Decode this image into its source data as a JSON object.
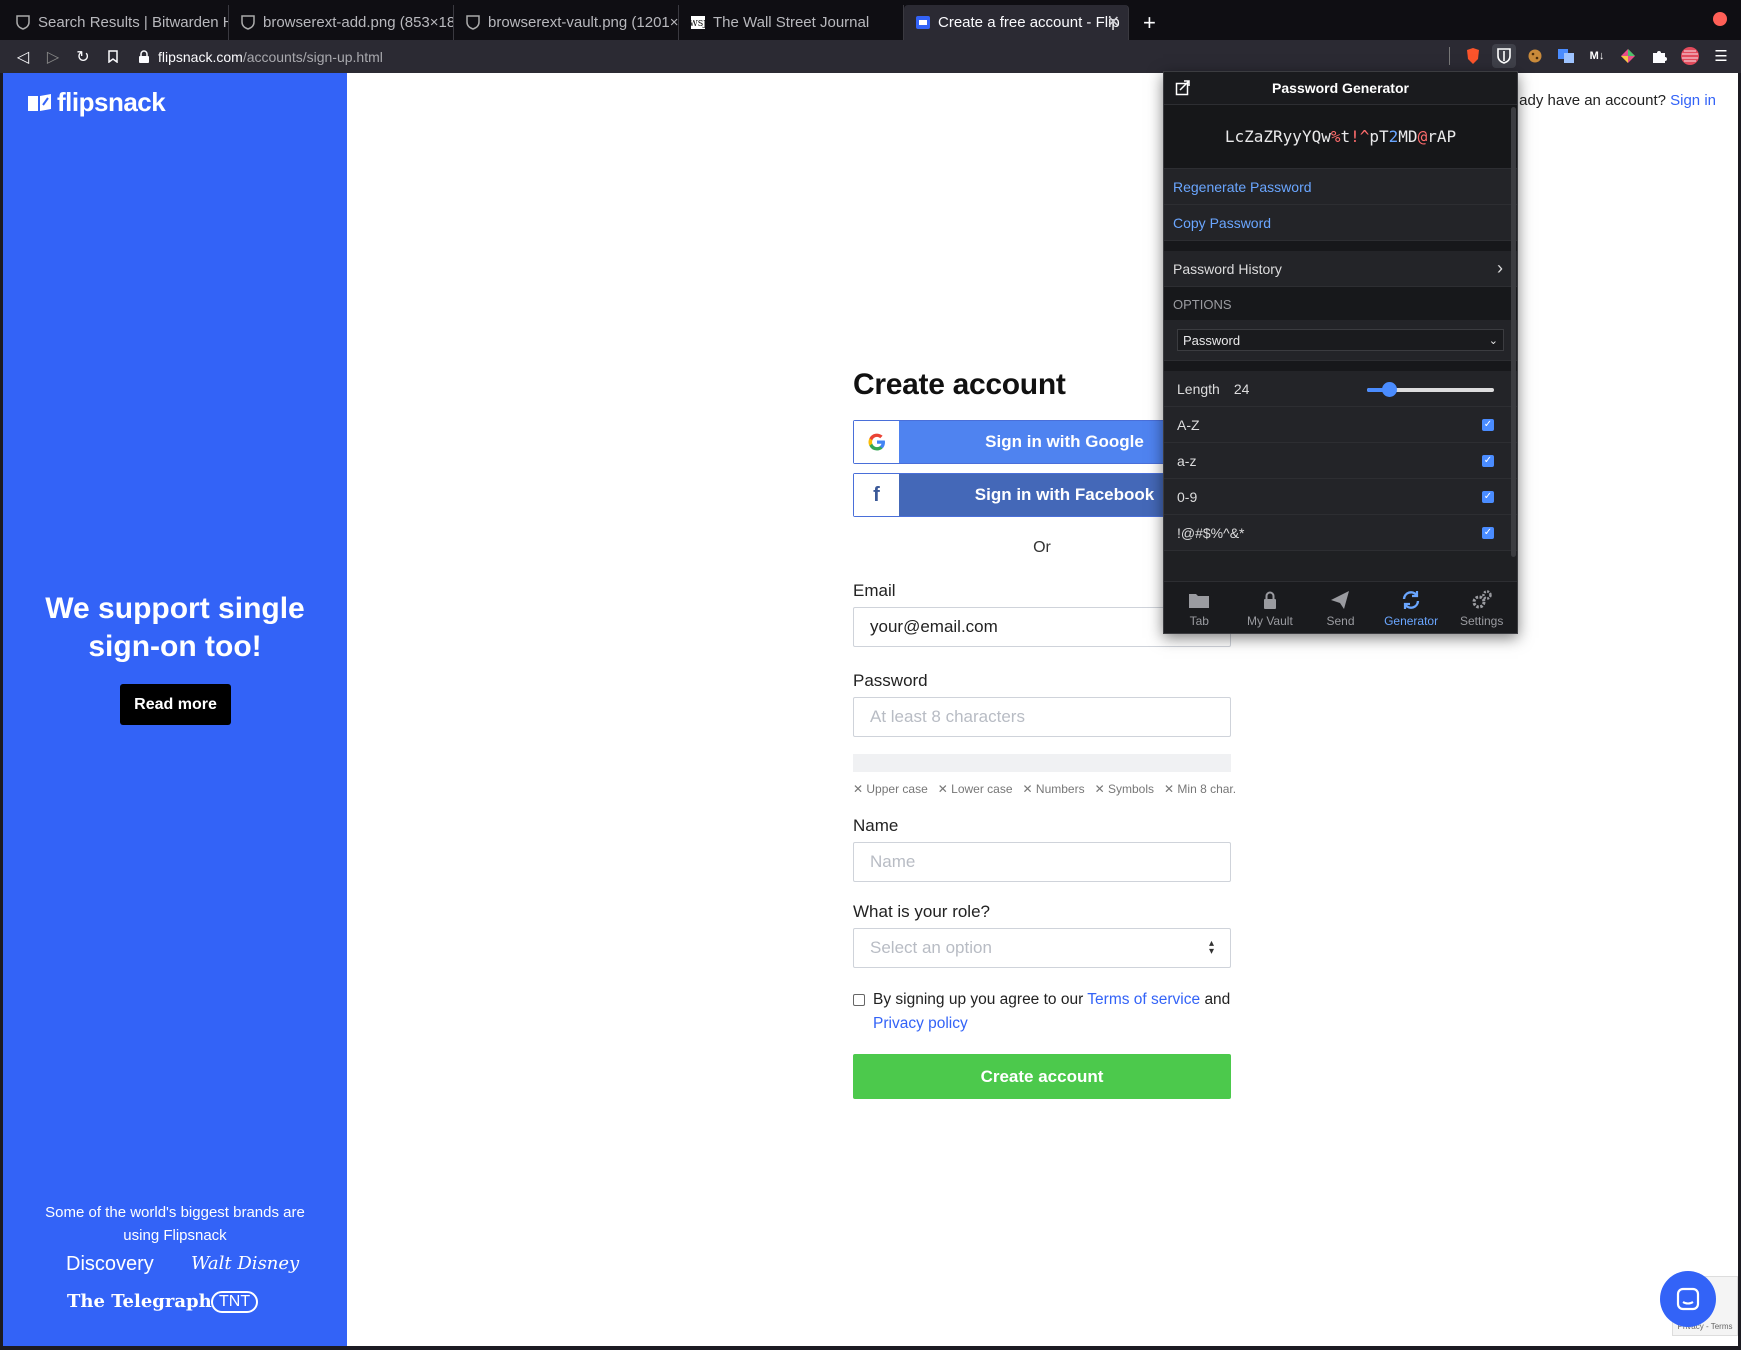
{
  "browser": {
    "tabs": [
      {
        "title": "Search Results | Bitwarden He",
        "active": false
      },
      {
        "title": "browserext-add.png (853×18",
        "active": false
      },
      {
        "title": "browserext-vault.png (1201×",
        "active": false
      },
      {
        "title": "The Wall Street Journal",
        "active": false
      },
      {
        "title": "Create a free account - Flip",
        "active": true
      }
    ],
    "url_host": "flipsnack.com",
    "url_path": "/accounts/sign-up.html"
  },
  "left_panel": {
    "logo": "flipsnack",
    "sso_title": "We support single sign-on too!",
    "read_more": "Read more",
    "brands_text": "Some of the world's biggest brands are using Flipsnack",
    "brands": [
      "Discovery",
      "Walt Disney",
      "The Telegraph",
      "TNT"
    ]
  },
  "top_right": {
    "text": "ady have an account?",
    "sign_in": "Sign in"
  },
  "form": {
    "title": "Create account",
    "google_button": "Sign in with Google",
    "facebook_button": "Sign in with Facebook",
    "or": "Or",
    "email_label": "Email",
    "email_value": "your@email.com",
    "password_label": "Password",
    "password_placeholder": "At least 8 characters",
    "requirements": [
      "Upper case",
      "Lower case",
      "Numbers",
      "Symbols",
      "Min 8 char."
    ],
    "name_label": "Name",
    "name_placeholder": "Name",
    "role_label": "What is your role?",
    "role_placeholder": "Select an option",
    "agree_text": "By signing up you agree to our",
    "terms": "Terms of service",
    "and": "and",
    "privacy": "Privacy policy",
    "create_button": "Create account"
  },
  "bitwarden": {
    "title": "Password Generator",
    "password_parts": [
      {
        "t": "LcZaZRyyYQw",
        "k": "n"
      },
      {
        "t": "%",
        "k": "s"
      },
      {
        "t": "t",
        "k": "n"
      },
      {
        "t": "!^",
        "k": "s"
      },
      {
        "t": "pT",
        "k": "n"
      },
      {
        "t": "2",
        "k": "d"
      },
      {
        "t": "MD",
        "k": "n"
      },
      {
        "t": "@",
        "k": "s"
      },
      {
        "t": "rAP",
        "k": "n"
      }
    ],
    "regenerate": "Regenerate Password",
    "copy": "Copy Password",
    "history": "Password History",
    "options_header": "OPTIONS",
    "type_value": "Password",
    "length_label": "Length",
    "length_value": "24",
    "length_fraction": 0.17,
    "checks": [
      {
        "label": "A-Z",
        "checked": true
      },
      {
        "label": "a-z",
        "checked": true
      },
      {
        "label": "0-9",
        "checked": true
      },
      {
        "label": "!@#$%^&*",
        "checked": true
      }
    ],
    "nav": [
      "Tab",
      "My Vault",
      "Send",
      "Generator",
      "Settings"
    ],
    "active_nav": "Generator",
    "colors": {
      "special": "#ff6c6c",
      "digit": "#6aa6ff",
      "accent": "#4a8cff"
    }
  },
  "colors": {
    "brand_blue": "#3363f7",
    "create_green": "#4cc94c"
  }
}
